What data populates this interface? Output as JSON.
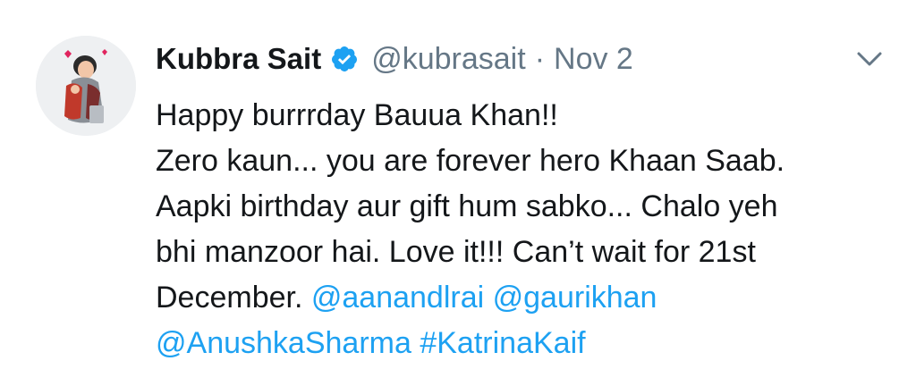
{
  "user": {
    "name": "Kubbra Sait",
    "handle": "@kubrasait",
    "separator": "·",
    "date": "Nov 2",
    "verified_icon": "verified-badge-icon"
  },
  "menu": {
    "icon": "chevron-down-icon"
  },
  "tweet": {
    "line1": "Happy burrrday Bauua Khan!!",
    "line2": "Zero kaun... you are forever hero Khaan Saab.",
    "line3": "Aapki birthday aur gift hum sabko... Chalo yeh",
    "line4": "bhi manzoor hai. Love it!!! Can’t wait for 21st",
    "line5_text": "December.",
    "mention1": "@aanandlrai",
    "mention2": "@gaurikhan",
    "mention3": "@AnushkaSharma",
    "hashtag": "#KatrinaKaif"
  },
  "colors": {
    "link": "#1da1f2",
    "text": "#14171a",
    "secondary": "#657786",
    "verified": "#1da1f2"
  }
}
